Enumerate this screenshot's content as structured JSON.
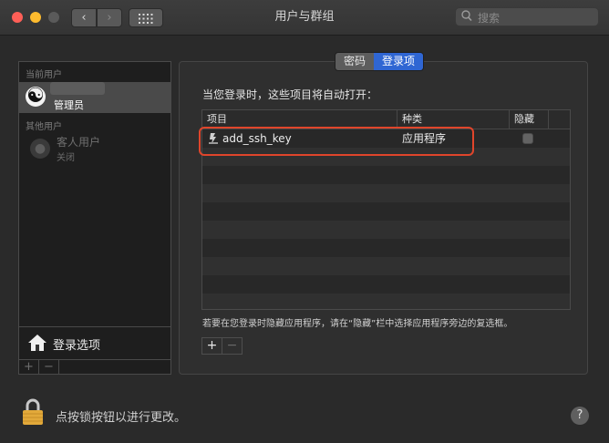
{
  "window": {
    "title": "用户与群组",
    "nav_back": "‹",
    "nav_forward": "›",
    "grid": "⋮⋮⋮"
  },
  "search": {
    "placeholder": "搜索",
    "value": ""
  },
  "sidebar": {
    "current_user_label": "当前用户",
    "current_user": {
      "role": "管理员"
    },
    "other_users_label": "其他用户",
    "guest": {
      "name": "客人用户",
      "status": "关闭"
    },
    "login_options": "登录选项",
    "add": "+",
    "remove": "−"
  },
  "tabs": {
    "password": "密码",
    "login_items": "登录项",
    "selected": "登录项"
  },
  "panel": {
    "heading": "当您登录时，这些项目将自动打开：",
    "columns": {
      "item": "项目",
      "kind": "种类",
      "hide": "隐藏"
    },
    "rows": [
      {
        "item": "add_ssh_key",
        "kind": "应用程序",
        "hidden": false
      }
    ],
    "hint": "若要在您登录时隐藏应用程序，请在“隐藏”栏中选择应用程序旁边的复选框。",
    "add": "+",
    "remove": "−"
  },
  "footer": {
    "lock_text": "点按锁按钮以进行更改。",
    "help": "?"
  },
  "colors": {
    "accent": "#2f66d3",
    "highlight": "#e0452b"
  },
  "icons": {
    "search": "search-icon",
    "house": "house-icon",
    "lock": "lock-icon",
    "yin_yang": "yin-yang-avatar",
    "app": "script-app-icon"
  }
}
